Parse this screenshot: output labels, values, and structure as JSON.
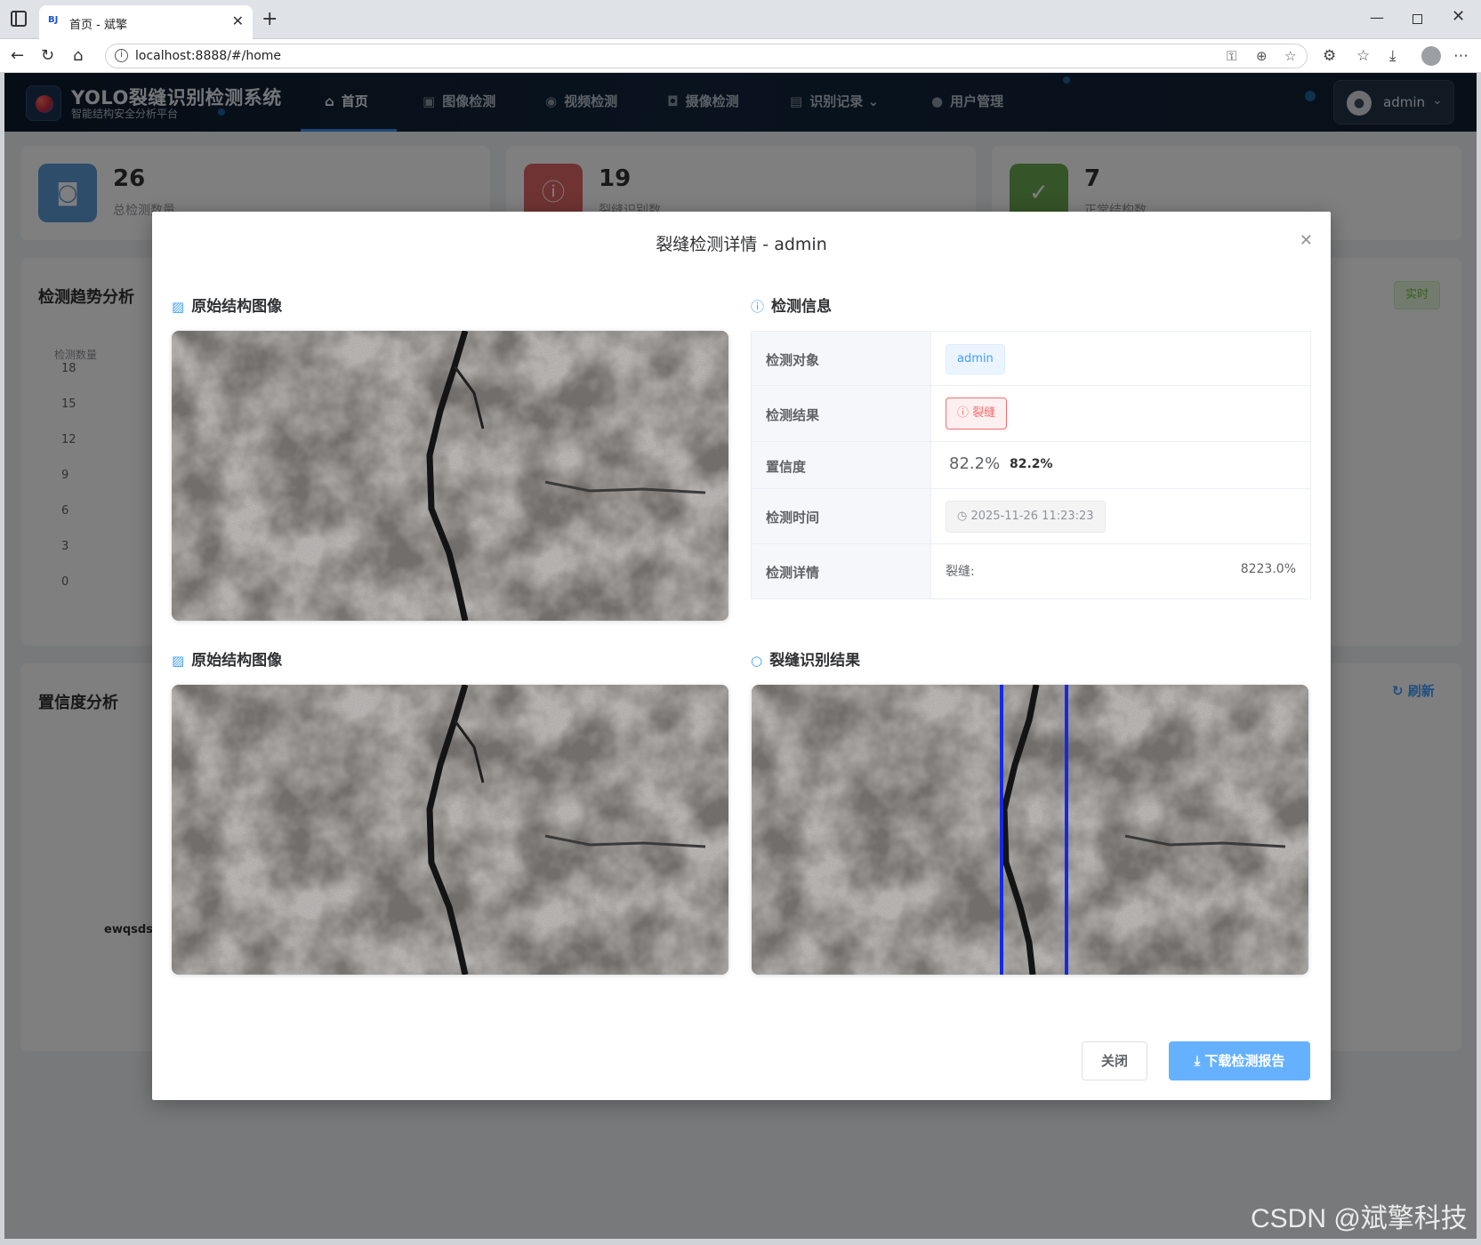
{
  "browser": {
    "tab_title": "首页 - 斌擎",
    "tab_favicon": "BJ",
    "url": "localhost:8888/#/home"
  },
  "header": {
    "brand_title": "YOLO裂缝识别检测系统",
    "brand_subtitle": "智能结构安全分析平台",
    "nav": [
      {
        "label": "首页",
        "icon": "home-icon"
      },
      {
        "label": "图像检测",
        "icon": "image-icon"
      },
      {
        "label": "视频检测",
        "icon": "video-icon"
      },
      {
        "label": "摄像检测",
        "icon": "camera-icon"
      },
      {
        "label": "识别记录",
        "icon": "document-icon"
      },
      {
        "label": "用户管理",
        "icon": "user-icon"
      }
    ],
    "user_name": "admin"
  },
  "dashboard": {
    "stats": [
      {
        "value": "26",
        "label": "总检测数量",
        "color": "#5b9bd5",
        "icon": "camera-icon"
      },
      {
        "value": "19",
        "label": "裂缝识别数",
        "color": "#e06666",
        "icon": "alert-icon"
      },
      {
        "value": "7",
        "label": "正常结构数",
        "color": "#6aa84f",
        "icon": "check-icon"
      }
    ],
    "trend_title": "检测趋势分析",
    "trend_axis_title": "检测数量",
    "trend_ticks": [
      "18",
      "15",
      "12",
      "9",
      "6",
      "3",
      "0"
    ],
    "realtime_label": "实时",
    "confidence_title": "置信度分析",
    "refresh_label": "刷新",
    "partial_label": "ewqsdsa"
  },
  "dialog": {
    "title": "裂缝检测详情 - admin",
    "original_title": "原始结构图像",
    "info_title": "检测信息",
    "original_title_2": "原始结构图像",
    "result_title": "裂缝识别结果",
    "rows": {
      "object_key": "检测对象",
      "object_value": "admin",
      "result_key": "检测结果",
      "result_value": "裂缝",
      "confidence_key": "置信度",
      "confidence_value": "82.2%",
      "confidence_value_bold": "82.2%",
      "time_key": "检测时间",
      "time_value": "2025-11-26 11:23:23",
      "detail_key": "检测详情",
      "detail_label": "裂缝:",
      "detail_value": "8223.0%"
    },
    "close_label": "关闭",
    "download_label": "下载检测报告",
    "accent": "#409eff",
    "danger": "#f56c6c"
  },
  "watermark": "CSDN @斌擎科技"
}
